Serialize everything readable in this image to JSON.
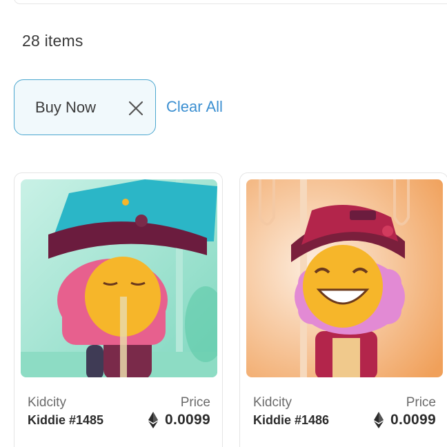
{
  "results": {
    "count_text": "28 items"
  },
  "filters": {
    "active": [
      {
        "label": "Buy Now",
        "remove_icon": "close-icon"
      }
    ],
    "clear_all_label": "Clear All"
  },
  "cards": [
    {
      "collection": "Kidcity",
      "name": "Kiddie #1485",
      "price_label": "Price",
      "price": "0.0099",
      "currency_icon": "ethereum-icon",
      "image_background": "#9fe0cf"
    },
    {
      "collection": "Kidcity",
      "name": "Kiddie #1486",
      "price_label": "Price",
      "price": "0.0099",
      "currency_icon": "ethereum-icon",
      "image_background": "#f3b47a"
    }
  ],
  "colors": {
    "accent": "#3b8fd1",
    "chip_border": "#4aa6cf",
    "chip_bg": "#f1f9fc"
  }
}
